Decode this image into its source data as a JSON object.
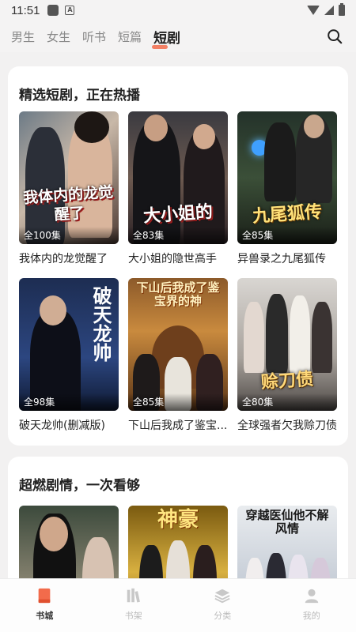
{
  "status_bar": {
    "time": "11:51"
  },
  "tabs": [
    {
      "label": "男生",
      "active": false
    },
    {
      "label": "女生",
      "active": false
    },
    {
      "label": "听书",
      "active": false
    },
    {
      "label": "短篇",
      "active": false
    },
    {
      "label": "短剧",
      "active": true
    }
  ],
  "sections": [
    {
      "title": "精选短剧，正在热播",
      "items": [
        {
          "title": "我体内的龙觉醒了",
          "episodes": "全100集",
          "cover_text": "我体内的龙觉醒了"
        },
        {
          "title": "大小姐的隐世高手",
          "episodes": "全83集",
          "cover_text": "大小姐的"
        },
        {
          "title": "异兽录之九尾狐传",
          "episodes": "全85集",
          "cover_text": "九尾狐传"
        },
        {
          "title": "破天龙帅(删减版)",
          "episodes": "全98集",
          "cover_text": "破天龙帅"
        },
        {
          "title": "下山后我成了鉴宝...",
          "episodes": "全85集",
          "cover_text": "下山后我成了鉴宝界的神"
        },
        {
          "title": "全球强者欠我赊刀债",
          "episodes": "全80集",
          "cover_text": "赊刀债"
        }
      ]
    },
    {
      "title": "超燃剧情，一次看够",
      "items": [
        {
          "cover_text": ""
        },
        {
          "cover_text": "神豪"
        },
        {
          "cover_text": "穿越医仙他不解风情"
        }
      ]
    }
  ],
  "bottom_nav": [
    {
      "label": "书城",
      "icon": "book-store-icon",
      "active": true
    },
    {
      "label": "书架",
      "icon": "bookshelf-icon",
      "active": false
    },
    {
      "label": "分类",
      "icon": "category-layers-icon",
      "active": false
    },
    {
      "label": "我的",
      "icon": "profile-icon",
      "active": false
    }
  ],
  "colors": {
    "accent": "#f26b4b",
    "background": "#f2f1f1"
  }
}
